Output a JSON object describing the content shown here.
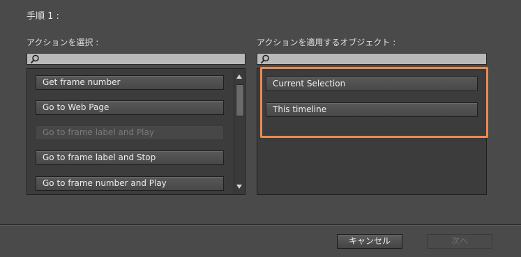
{
  "step_title": "手順 1 :",
  "left": {
    "label": "アクションを選択 :",
    "search_placeholder": "",
    "items": [
      {
        "label": "Get frame number",
        "disabled": false
      },
      {
        "label": "Go to Web Page",
        "disabled": false
      },
      {
        "label": "Go to frame label and Play",
        "disabled": true
      },
      {
        "label": "Go to frame label and Stop",
        "disabled": false
      },
      {
        "label": "Go to frame number and Play",
        "disabled": false
      }
    ]
  },
  "right": {
    "label": "アクションを適用するオブジェクト :",
    "search_placeholder": "",
    "items": [
      {
        "label": "Current Selection"
      },
      {
        "label": "This timeline"
      }
    ]
  },
  "buttons": {
    "cancel": "キャンセル",
    "next": "次へ"
  },
  "colors": {
    "background": "#4a4a4a",
    "highlight": "#ec8a4f"
  }
}
